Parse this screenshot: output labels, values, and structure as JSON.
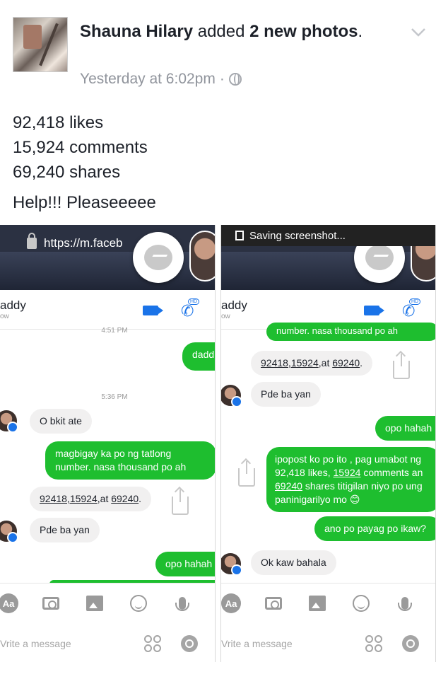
{
  "post": {
    "author": "Shauna Hilary",
    "action_prefix": " added ",
    "action_bold": "2 new photos",
    "action_suffix": ".",
    "timestamp": "Yesterday at 6:02pm",
    "separator": "·",
    "stats": [
      "92,418 likes",
      "15,924 comments",
      "69,240 shares"
    ],
    "text": "Help!!! Pleaseeeee"
  },
  "screenshot_left": {
    "url": "https://m.faceb",
    "contact": "addy",
    "contact_sub": "ow",
    "hd": "HD",
    "time_top": "4:51 PM",
    "time_mid": "5:36 PM",
    "msg_daddy": "dadd",
    "msg_obkit": "O bkit ate",
    "msg_numbers": "magbigay ka po ng tatlong number. nasa thousand po ah",
    "msg_numbers_reply_parts": [
      "92418,15924",
      ",at ",
      "69240",
      "."
    ],
    "msg_pde": "Pde ba yan",
    "msg_opo": "opo hahah",
    "toolbar_aa": "Aa",
    "placeholder": "Vrite a message"
  },
  "screenshot_right": {
    "status": "Saving screenshot...",
    "contact": "addy",
    "contact_sub": "ow",
    "hd": "HD",
    "msg_top": "number. nasa thousand po ah",
    "msg_numbers_reply_parts": [
      "92418,15924",
      ",at ",
      "69240",
      "."
    ],
    "msg_pde": "Pde ba yan",
    "msg_opo": "opo hahah",
    "msg_ipopost_parts": [
      "ipopost ko po ito , pag umabot ng 92,418 likes, ",
      "15924",
      " comments an ",
      "69240",
      " shares titigilan niyo po ung paninigarilyo mo 😊"
    ],
    "msg_ano": "ano po payag po ikaw?",
    "msg_ok": "Ok kaw bahala",
    "toolbar_aa": "Aa",
    "placeholder": "Vrite a message"
  }
}
